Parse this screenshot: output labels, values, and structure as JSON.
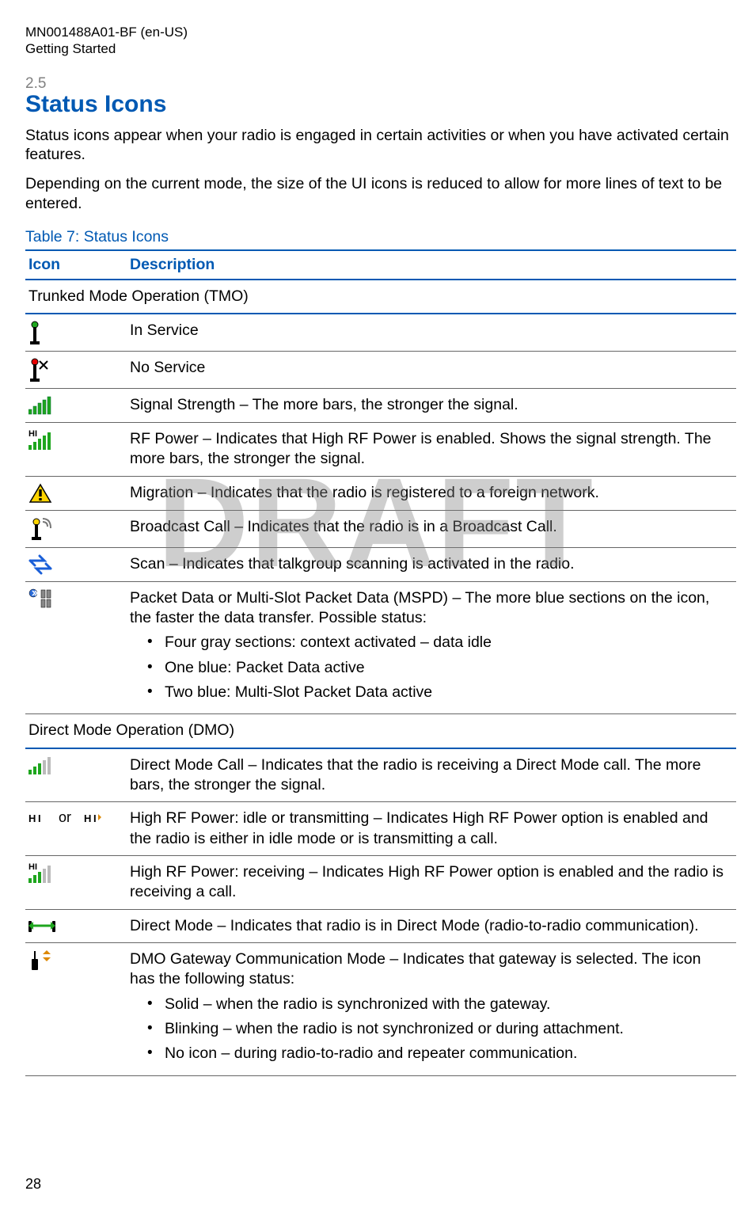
{
  "header": {
    "doc_id": "MN001488A01-BF (en-US)",
    "doc_section": "Getting Started"
  },
  "section": {
    "num": "2.5",
    "title": "Status Icons"
  },
  "intro": {
    "p1": "Status icons appear when your radio is engaged in certain activities or when you have activated certain features.",
    "p2": "Depending on the current mode, the size of the UI icons is reduced to allow for more lines of text to be entered."
  },
  "table": {
    "title": "Table 7: Status Icons",
    "headers": {
      "icon": "Icon",
      "desc": "Description"
    },
    "groups": {
      "tmo": "Trunked Mode Operation (TMO)",
      "dmo": "Direct Mode Operation (DMO)"
    },
    "rows": {
      "in_service": {
        "desc": "In Service"
      },
      "no_service": {
        "desc": "No Service"
      },
      "signal": {
        "desc": "Signal Strength – The more bars, the stronger the signal."
      },
      "rf_power": {
        "desc": "RF Power – Indicates that High RF Power is enabled. Shows the signal strength. The more bars, the stronger the signal."
      },
      "migration": {
        "desc": "Migration – Indicates that the radio is registered to a foreign network."
      },
      "broadcast": {
        "desc": "Broadcast Call – Indicates that the radio is in a Broadcast Call."
      },
      "scan": {
        "desc": "Scan – Indicates that talkgroup scanning is activated in the radio."
      },
      "packet": {
        "desc": "Packet Data or Multi-Slot Packet Data (MSPD) – The more blue sections on the icon, the faster the data transfer. Possible status:",
        "b1": "Four gray sections: context activated – data idle",
        "b2": "One blue: Packet Data active",
        "b3": "Two blue: Multi-Slot Packet Data active"
      },
      "dm_call": {
        "desc": "Direct Mode Call – Indicates that the radio is receiving a Direct Mode call. The more bars, the stronger the signal."
      },
      "hrf_idle_tx": {
        "or": "or",
        "desc": "High RF Power: idle or transmitting – Indicates High RF Power option is enabled and the radio is either in idle mode or is transmitting a call."
      },
      "hrf_rx": {
        "desc": "High RF Power: receiving – Indicates High RF Power option is enabled and the radio is receiving a call."
      },
      "direct_mode": {
        "desc": "Direct Mode – Indicates that radio is in Direct Mode (radio-to-radio communication)."
      },
      "dmo_gw": {
        "desc": "DMO Gateway Communication Mode – Indicates that gateway is selected. The icon has the following status:",
        "b1": "Solid – when the radio is synchronized with the gateway.",
        "b2": "Blinking – when the radio is not synchronized or during attachment.",
        "b3": "No icon – during radio-to-radio and repeater communication."
      }
    }
  },
  "watermark": "DRAFT",
  "page_number": "28"
}
